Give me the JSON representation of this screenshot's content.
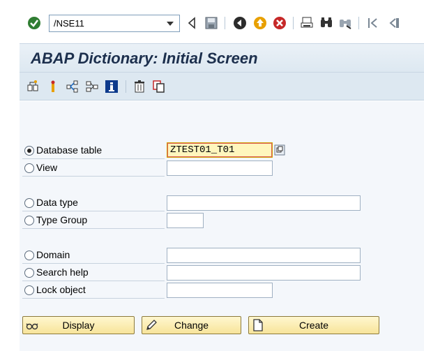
{
  "toolbar": {
    "command_field": "/NSE11",
    "icons": [
      "enter-icon",
      "back-icon",
      "save-icon",
      "back-arrow-icon",
      "exit-icon",
      "cancel-icon",
      "print-icon",
      "find-icon",
      "find-next-icon",
      "first-page-icon",
      "next-page-icon"
    ]
  },
  "window": {
    "title": "ABAP Dictionary: Initial Screen"
  },
  "app_toolbar": {
    "icons": [
      "other-object-icon",
      "where-used-icon",
      "display-navigate-icon",
      "object-list-icon",
      "info-icon",
      "delete-icon",
      "copy-icon"
    ]
  },
  "form": {
    "database_table_label": "Database table",
    "database_table_value": "ZTEST01_T01",
    "view_label": "View",
    "view_value": "",
    "data_type_label": "Data type",
    "data_type_value": "",
    "type_group_label": "Type Group",
    "type_group_value": "",
    "domain_label": "Domain",
    "domain_value": "",
    "search_help_label": "Search help",
    "search_help_value": "",
    "lock_object_label": "Lock object",
    "lock_object_value": "",
    "selected": "database_table"
  },
  "buttons": {
    "display": "Display",
    "change": "Change",
    "create": "Create"
  },
  "colors": {
    "title": "#1c2f4d",
    "title_bg": "#dde8f1",
    "button_bg": "#f7e49a",
    "focus_field_bg": "#fff6bd"
  }
}
